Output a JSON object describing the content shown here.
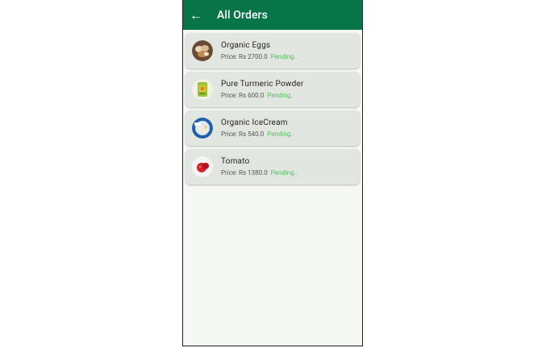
{
  "appbar": {
    "back_icon": "arrow-left-icon",
    "title": "All Orders",
    "color": "#087548"
  },
  "orders": [
    {
      "name": "Organic Eggs",
      "price": "Price: Rs 2700.0",
      "status": "Pending..",
      "image": "eggs-image"
    },
    {
      "name": "Pure Turmeric Powder",
      "price": "Price: Rs 600.0",
      "status": "Pending..",
      "image": "turmeric-image"
    },
    {
      "name": "Organic IceCream",
      "price": "Price: Rs 540.0",
      "status": "Pending..",
      "image": "icecream-image"
    },
    {
      "name": "Tomato",
      "price": "Price: Rs 1380.0",
      "status": "Pending..",
      "image": "tomato-image"
    }
  ],
  "colors": {
    "pending": "#4fbf5a",
    "card_bg": "#e2e6e1",
    "page_bg": "#f6f8f4"
  }
}
